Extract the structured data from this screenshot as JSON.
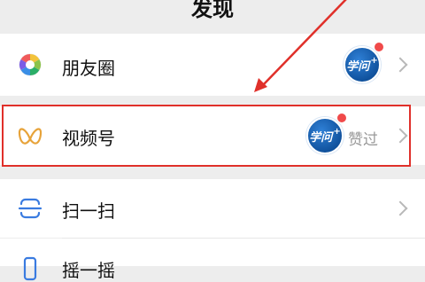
{
  "header": {
    "title": "发现"
  },
  "rows": [
    {
      "label": "朋友圈"
    },
    {
      "label": "视频号",
      "status_text": "赞过"
    },
    {
      "label": "扫一扫"
    },
    {
      "label": "摇一摇"
    }
  ],
  "badge_avatar": {
    "text": "学问",
    "plus": "+"
  },
  "colors": {
    "highlight": "#e0302a",
    "badge_dot": "#f04a4a",
    "avatar": "#1d63b6"
  }
}
